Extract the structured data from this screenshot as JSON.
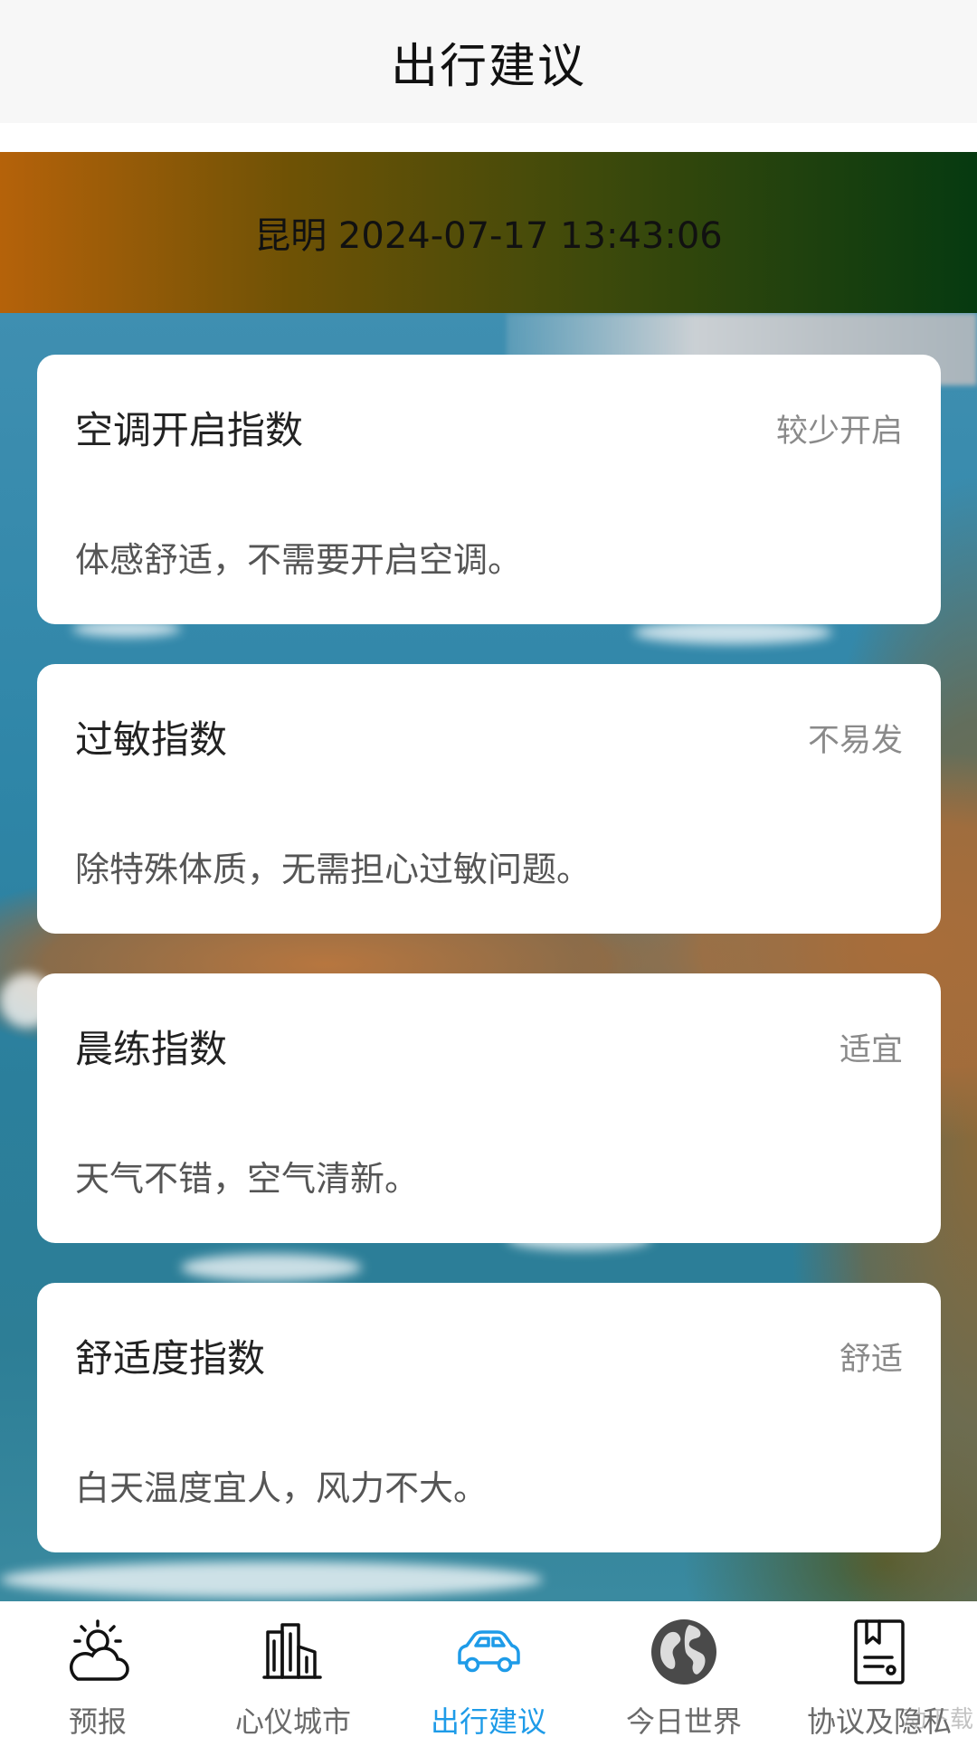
{
  "header": {
    "title": "出行建议"
  },
  "location": {
    "text": "昆明 2024-07-17 13:43:06"
  },
  "cards": [
    {
      "title": "空调开启指数",
      "level": "较少开启",
      "desc": "体感舒适，不需要开启空调。"
    },
    {
      "title": "过敏指数",
      "level": "不易发",
      "desc": "除特殊体质，无需担心过敏问题。"
    },
    {
      "title": "晨练指数",
      "level": "适宜",
      "desc": "天气不错，空气清新。"
    },
    {
      "title": "舒适度指数",
      "level": "舒适",
      "desc": "白天温度宜人，风力不大。"
    }
  ],
  "nav": {
    "items": [
      {
        "label": "预报",
        "icon": "weather-cloud-sun-icon"
      },
      {
        "label": "心仪城市",
        "icon": "city-buildings-icon"
      },
      {
        "label": "出行建议",
        "icon": "car-icon",
        "active": true
      },
      {
        "label": "今日世界",
        "icon": "globe-icon"
      },
      {
        "label": "协议及隐私",
        "icon": "document-bookmark-icon"
      }
    ]
  },
  "watermark": {
    "text": "动下载"
  },
  "colors": {
    "active": "#1e9be8",
    "inactive": "#6a6a6a",
    "gradient_start": "#b5620a",
    "gradient_end": "#063a10"
  }
}
